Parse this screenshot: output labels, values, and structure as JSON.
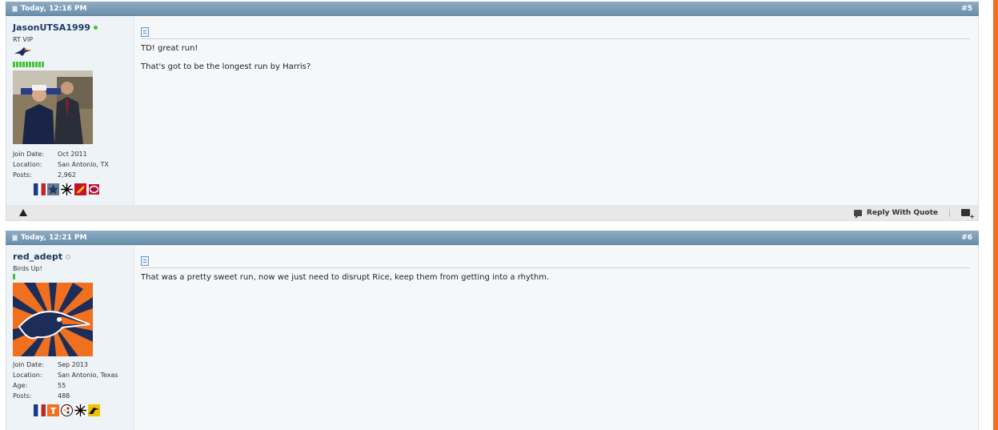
{
  "posts": [
    {
      "date": "Today, 12:16 PM",
      "number": "#5",
      "username": "JasonUTSA1999",
      "online": true,
      "user_title": "RT VIP",
      "rep_segments": 10,
      "stats": [
        {
          "label": "Join Date:",
          "value": "Oct 2011"
        },
        {
          "label": "Location:",
          "value": "San Antonio, TX"
        },
        {
          "label": "Posts:",
          "value": "2,962"
        }
      ],
      "badges": [
        "texas-flag-icon",
        "cowboys-star-icon",
        "spurs-icon",
        "rockets-icon",
        "canadiens-icon"
      ],
      "message": [
        "TD! great run!",
        "That's got to be the longest run by Harris?"
      ],
      "footer": {
        "reply_with_quote": "Reply With Quote"
      }
    },
    {
      "date": "Today, 12:21 PM",
      "number": "#6",
      "username": "red_adept",
      "online": false,
      "user_title": "Birds Up!",
      "rep_segments": 1,
      "stats": [
        {
          "label": "Join Date:",
          "value": "Sep 2013"
        },
        {
          "label": "Location:",
          "value": "San Antonio, Texas"
        },
        {
          "label": "Age:",
          "value": "55"
        },
        {
          "label": "Posts:",
          "value": "488"
        }
      ],
      "badges": [
        "texas-flag-icon",
        "longhorns-icon",
        "steelers-icon",
        "spurs-icon",
        "roadrunner-icon"
      ],
      "message": [
        "That was a pretty sweet run, now we just need to disrupt Rice, keep them from getting into a rhythm."
      ]
    }
  ],
  "colors": {
    "header": "#7b9bb5",
    "accent": "#f07020",
    "online": "#46c23a",
    "offline": "#aaaaaa"
  }
}
